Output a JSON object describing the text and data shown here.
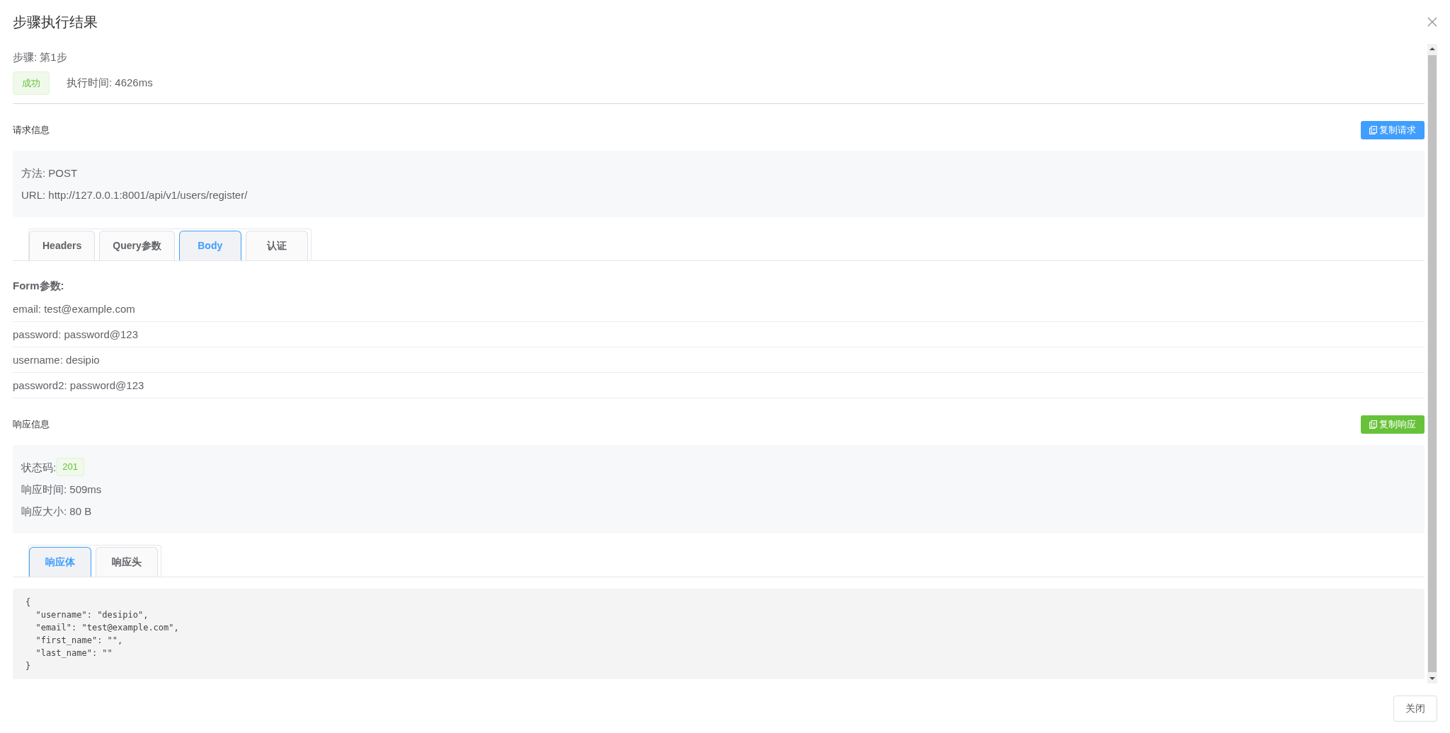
{
  "dialog": {
    "title": "步骤执行结果",
    "close_button": "关闭"
  },
  "step": {
    "label": "步骤: 第1步",
    "status": {
      "text": "成功",
      "kind": "success"
    },
    "duration": "执行时间: 4626ms"
  },
  "request": {
    "heading": "请求信息",
    "copy_button": "复制请求",
    "method": "方法: POST",
    "url": "URL: http://127.0.0.1:8001/api/v1/users/register/",
    "tabs": [
      {
        "label": "Headers",
        "selected": false
      },
      {
        "label": "Query参数",
        "selected": false
      },
      {
        "label": "Body",
        "selected": true
      },
      {
        "label": "认证",
        "selected": false
      }
    ],
    "body_heading": "Form参数:",
    "params": [
      "email: test@example.com",
      "password: password@123",
      "username: desipio",
      "password2: password@123"
    ]
  },
  "response": {
    "heading": "响应信息",
    "copy_button": "复制响应",
    "status_label": "状态码:",
    "status_code": "201",
    "time": "响应时间: 509ms",
    "size": "响应大小: 80 B",
    "tabs": [
      {
        "label": "响应体",
        "selected": true
      },
      {
        "label": "响应头",
        "selected": false
      }
    ],
    "body_lines": [
      "{",
      "  \"username\": \"desipio\",",
      "  \"email\": \"test@example.com\",",
      "  \"first_name\": \"\",",
      "  \"last_name\": \"\"",
      "}"
    ]
  }
}
